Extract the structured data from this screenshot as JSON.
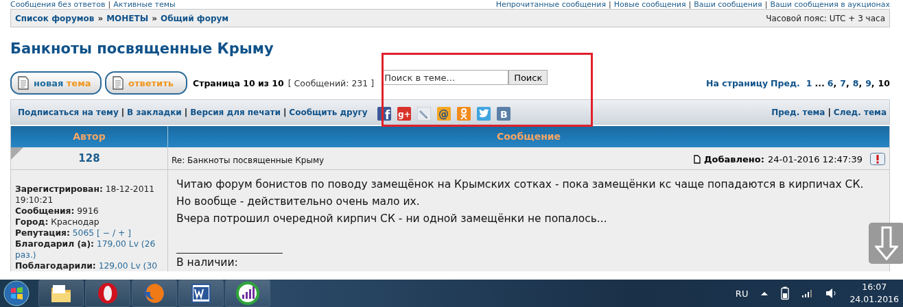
{
  "top_links": {
    "left": [
      "Сообщения без ответов",
      "Активные темы"
    ],
    "right": [
      "Непрочитанные сообщения",
      "Новые сообщения",
      "Ваши сообщения",
      "Ваши сообщения в аукционах"
    ],
    "separator": "|"
  },
  "breadcrumb": {
    "items": [
      "Список форумов",
      "МОНЕТЫ",
      "Общий форум"
    ],
    "separator": "»",
    "timezone": "Часовой пояс: UTC + 3 часа"
  },
  "topic_title": "Банкноты посвященные Крыму",
  "actions": [
    {
      "kind": "new_topic",
      "parts": [
        {
          "text": "новая",
          "color": "#1f6b9e"
        },
        {
          "text": "тема",
          "color": "#f0951e"
        }
      ]
    },
    {
      "kind": "reply",
      "parts": [
        {
          "text": "ответить",
          "color": "#f0951e"
        }
      ]
    }
  ],
  "page_status": "Страница 10 из 10",
  "post_count": "[ Сообщений: 231 ]",
  "search": {
    "placeholder": "Поиск в теме...",
    "button": "Поиск"
  },
  "pagination": {
    "label": "На страницу",
    "prev": "Пред.",
    "separator": ",",
    "pages": [
      {
        "kind": "page",
        "text": "1",
        "selected": false
      },
      {
        "kind": "gap",
        "text": "..."
      },
      {
        "kind": "page",
        "text": "6",
        "selected": false
      },
      {
        "kind": "page",
        "text": "7",
        "selected": false
      },
      {
        "kind": "page",
        "text": "8",
        "selected": false
      },
      {
        "kind": "page",
        "text": "9",
        "selected": false
      },
      {
        "kind": "page",
        "text": "10",
        "selected": true
      }
    ]
  },
  "topic_tools": {
    "links": [
      "Подписаться на тему",
      "В закладки",
      "Версия для печати",
      "Сообщить другу"
    ],
    "separator": "|"
  },
  "share_buttons": [
    {
      "kind": "facebook",
      "glyph": "f"
    },
    {
      "kind": "googleplus",
      "glyph": "g+"
    },
    {
      "kind": "livejournal"
    },
    {
      "kind": "mail",
      "glyph": "@"
    },
    {
      "kind": "odnoklassniki"
    },
    {
      "kind": "twitter"
    },
    {
      "kind": "vkontakte",
      "glyph": "B"
    }
  ],
  "topic_nav": {
    "links": [
      "Пред. тема",
      "След. тема"
    ],
    "separator": "|"
  },
  "table": {
    "columns": [
      "Автор",
      "Сообщение"
    ],
    "posts": [
      {
        "author": "128",
        "subject": "Re: Банкноты посвященные Крыму",
        "added_label": "Добавлено:",
        "added": "24-01-2016 12:47:39",
        "profile": [
          {
            "label": "Зарегистрирован:",
            "value": "18-12-2011 19:10:21"
          },
          {
            "label": "Сообщения:",
            "value": "9916"
          },
          {
            "label": "Город:",
            "value": "Краснодар"
          },
          {
            "label": "Репутация:",
            "link": "5065",
            "value": "[ − / + ]"
          },
          {
            "label": "Благодарил (а):",
            "link": "179,00 Lv",
            "value": "(26 раз.)"
          },
          {
            "label": "Поблагодарили:",
            "link": "129,00 Lv",
            "value": "(30"
          }
        ],
        "text_lines": [
          "Читаю форум бонистов по поводу замещёнок на Крымских сотках - пока замещёнки кс чаще попадаются в кирпичах СК.",
          "Но вообще - действительно очень мало их.",
          "Вчера потрошил очередной кирпич СК - ни одной замещёнки не попалось..."
        ],
        "signature": "В наличии:"
      }
    ]
  },
  "taskbar": {
    "apps": [
      {
        "kind": "folder"
      },
      {
        "kind": "opera"
      },
      {
        "kind": "firefox"
      },
      {
        "kind": "word"
      },
      {
        "kind": "chart"
      }
    ],
    "language": "RU",
    "time": "16:07",
    "date": "24.01.2016"
  }
}
